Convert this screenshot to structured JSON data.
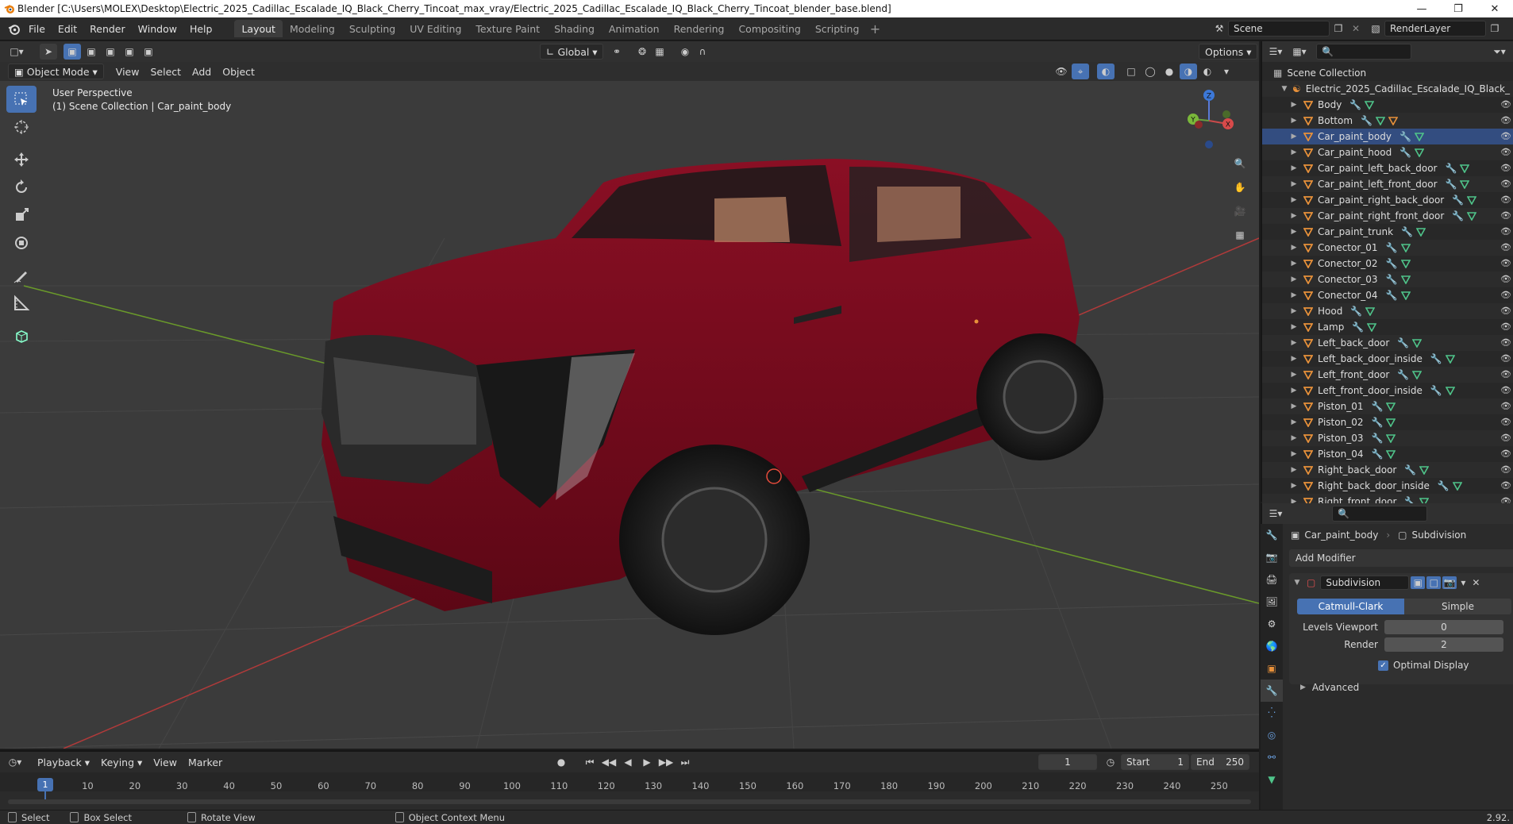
{
  "app": {
    "title": "Blender [C:\\Users\\MOLEX\\Desktop\\Electric_2025_Cadillac_Escalade_IQ_Black_Cherry_Tincoat_max_vray/Electric_2025_Cadillac_Escalade_IQ_Black_Cherry_Tincoat_blender_base.blend]"
  },
  "menus": [
    "File",
    "Edit",
    "Render",
    "Window",
    "Help"
  ],
  "workspaces": [
    "Layout",
    "Modeling",
    "Sculpting",
    "UV Editing",
    "Texture Paint",
    "Shading",
    "Animation",
    "Rendering",
    "Compositing",
    "Scripting"
  ],
  "active_workspace": "Layout",
  "scene": {
    "name": "Scene",
    "render_layer": "RenderLayer"
  },
  "viewport": {
    "transform_orientation": "Global",
    "options_label": "Options",
    "mode": "Object Mode",
    "menus": [
      "View",
      "Select",
      "Add",
      "Object"
    ],
    "overlay_line1": "User Perspective",
    "overlay_line2": "(1) Scene Collection | Car_paint_body",
    "gizmo_axes": {
      "x": "X",
      "y": "Y",
      "z": "Z"
    }
  },
  "outliner": {
    "root": "Scene Collection",
    "collection": "Electric_2025_Cadillac_Escalade_IQ_Black_",
    "items": [
      {
        "name": "Body",
        "icons": 2
      },
      {
        "name": "Bottom",
        "icons": 3
      },
      {
        "name": "Car_paint_body",
        "icons": 2,
        "selected": true
      },
      {
        "name": "Car_paint_hood",
        "icons": 2
      },
      {
        "name": "Car_paint_left_back_door",
        "icons": 2
      },
      {
        "name": "Car_paint_left_front_door",
        "icons": 2
      },
      {
        "name": "Car_paint_right_back_door",
        "icons": 2
      },
      {
        "name": "Car_paint_right_front_door",
        "icons": 2
      },
      {
        "name": "Car_paint_trunk",
        "icons": 2
      },
      {
        "name": "Conector_01",
        "icons": 2
      },
      {
        "name": "Conector_02",
        "icons": 2
      },
      {
        "name": "Conector_03",
        "icons": 2
      },
      {
        "name": "Conector_04",
        "icons": 2
      },
      {
        "name": "Hood",
        "icons": 2
      },
      {
        "name": "Lamp",
        "icons": 2
      },
      {
        "name": "Left_back_door",
        "icons": 2
      },
      {
        "name": "Left_back_door_inside",
        "icons": 2
      },
      {
        "name": "Left_front_door",
        "icons": 2
      },
      {
        "name": "Left_front_door_inside",
        "icons": 2
      },
      {
        "name": "Piston_01",
        "icons": 2
      },
      {
        "name": "Piston_02",
        "icons": 2
      },
      {
        "name": "Piston_03",
        "icons": 2
      },
      {
        "name": "Piston_04",
        "icons": 2
      },
      {
        "name": "Right_back_door",
        "icons": 2
      },
      {
        "name": "Right_back_door_inside",
        "icons": 2
      },
      {
        "name": "Right_front_door",
        "icons": 2
      }
    ]
  },
  "properties": {
    "object_name": "Car_paint_body",
    "modifier_crumb": "Subdivision",
    "add_modifier": "Add Modifier",
    "modifier_name": "Subdivision",
    "algo_tabs": [
      "Catmull-Clark",
      "Simple"
    ],
    "active_algo": "Catmull-Clark",
    "levels_viewport_label": "Levels Viewport",
    "levels_viewport_value": "0",
    "render_label": "Render",
    "render_value": "2",
    "optimal_display_label": "Optimal Display",
    "optimal_display_checked": true,
    "advanced_label": "Advanced"
  },
  "timeline": {
    "menus": [
      "Playback",
      "Keying",
      "View",
      "Marker"
    ],
    "current_frame": "1",
    "start_label": "Start",
    "start_value": "1",
    "end_label": "End",
    "end_value": "250",
    "ticks": [
      "10",
      "20",
      "30",
      "40",
      "50",
      "60",
      "70",
      "80",
      "90",
      "100",
      "110",
      "120",
      "130",
      "140",
      "150",
      "160",
      "170",
      "180",
      "190",
      "200",
      "210",
      "220",
      "230",
      "240",
      "250"
    ],
    "playhead": "1"
  },
  "status": {
    "select": "Select",
    "box_select": "Box Select",
    "rotate_view": "Rotate View",
    "context_menu": "Object Context Menu",
    "version": "2.92."
  },
  "colors": {
    "accent": "#4772b3",
    "car_paint": "#7a0a1e",
    "axis_red": "#b03a3a",
    "axis_green": "#6a9a2a",
    "object_orange": "#e8913a",
    "mesh_green": "#4fc48a",
    "wrench_blue": "#6aa0e0"
  }
}
